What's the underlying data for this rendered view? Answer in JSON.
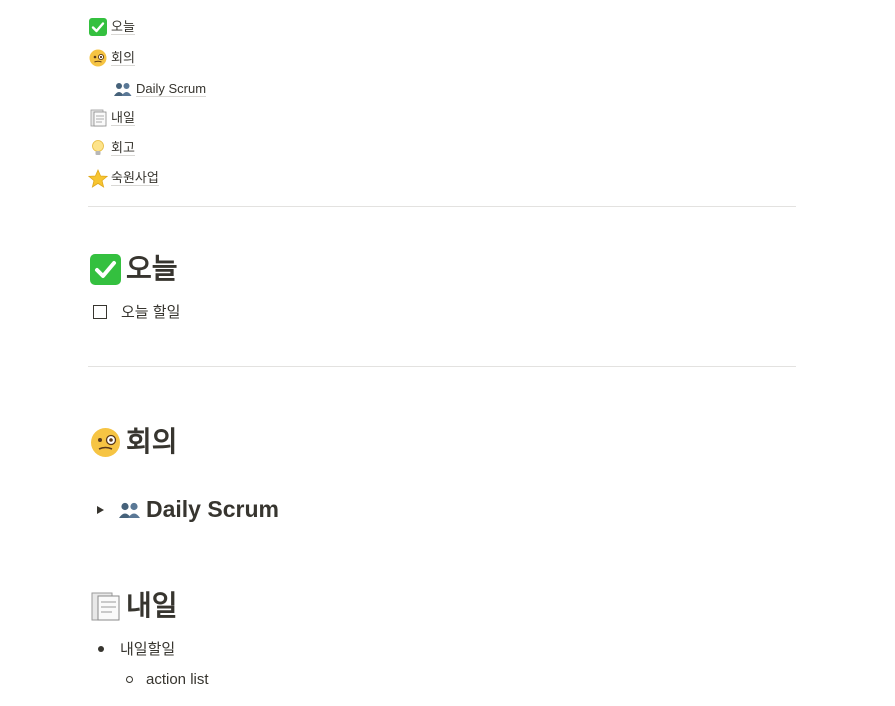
{
  "toc": [
    {
      "emoji": "check-icon",
      "label": "오늘"
    },
    {
      "emoji": "monocle-face-icon",
      "label": "회의"
    },
    {
      "emoji": "people-icon",
      "label": "Daily Scrum"
    },
    {
      "emoji": "document-icon",
      "label": "내일"
    },
    {
      "emoji": "bulb-icon",
      "label": "회고"
    },
    {
      "emoji": "star-icon",
      "label": "숙원사업"
    }
  ],
  "sections": {
    "today": {
      "title": "오늘",
      "todo": "오늘 할일"
    },
    "meeting": {
      "title": "회의",
      "toggle": "Daily Scrum"
    },
    "tomorrow": {
      "title": "내일",
      "bullet": "내일할일",
      "sub_bullet": "action list"
    }
  },
  "colors": {
    "text": "#37352f",
    "divider": "#e3e2e0",
    "check_green": "#34c03f",
    "star_yellow": "#f7c531"
  }
}
